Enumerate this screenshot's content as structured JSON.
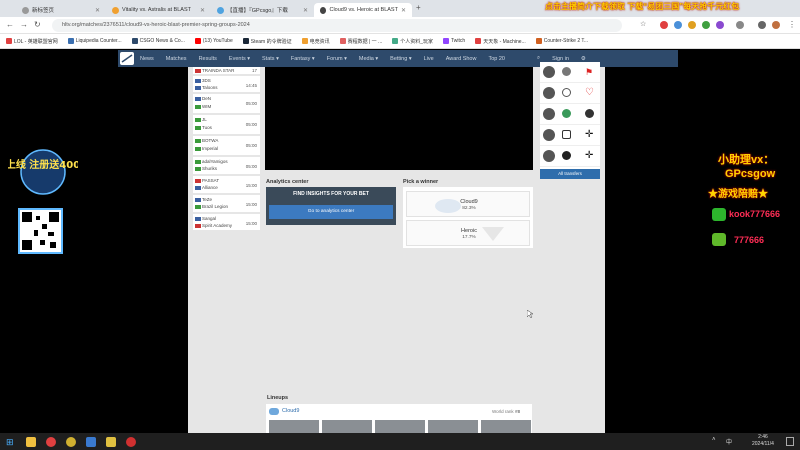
{
  "browser": {
    "tabs": [
      {
        "title": "新标签页",
        "color": "#999999"
      },
      {
        "title": "Vitality vs. Astralis at BLAST",
        "color": "#f0a030"
      },
      {
        "title": "【直播】『GPcsgo』下载",
        "color": "#4fa3e0"
      },
      {
        "title": "Cloud9 vs. Heroic at BLAST",
        "color": "#444444"
      }
    ],
    "new_tab": "+",
    "stream_banner": "点击主播简介下载领取 下载“易团三国”每天抢千元红包",
    "url": "hltv.org/matches/2376511/cloud9-vs-heroic-blast-premier-spring-groups-2024",
    "bookmarks": [
      {
        "label": "LOL - 英雄联盟官网",
        "color": "#e04040"
      },
      {
        "label": "Liquipedia Counter...",
        "color": "#3a6fb0"
      },
      {
        "label": "CSGO News & Co...",
        "color": "#2e4a6b"
      },
      {
        "label": "(13) YouTube",
        "color": "#ff0000"
      },
      {
        "label": "Steam 的令牌验证",
        "color": "#1b2838"
      },
      {
        "label": "电竞资讯",
        "color": "#f0a030"
      },
      {
        "label": "赛程数据 | 一 ...",
        "color": "#e06060"
      },
      {
        "label": "个人资料_玩家",
        "color": "#4a8"
      },
      {
        "label": "Twitch",
        "color": "#9146ff"
      },
      {
        "label": "天天象 - Machine...",
        "color": "#e04040"
      },
      {
        "label": "Counter-Strike 2 T...",
        "color": "#d06020"
      }
    ]
  },
  "nav": {
    "items": [
      "News",
      "Matches",
      "Results",
      "Events ▾",
      "Stats ▾",
      "Fantasy ▾",
      "Forum ▾",
      "Media ▾",
      "Betting ▾",
      "Live",
      "Award Show",
      "Top 20"
    ],
    "signin": "Sign in"
  },
  "matches": [
    {
      "t1": "TRAINDA STAR",
      "t2": "",
      "time": "17"
    },
    {
      "t1": "3DS",
      "t2": "Taloons",
      "time": "14:45"
    },
    {
      "t1": "DeN",
      "t2": "WIM",
      "time": "05:00"
    },
    {
      "t1": "JL",
      "t2": "Tuos",
      "time": "05:00"
    },
    {
      "t1": "BOTWA",
      "t2": "Imperial",
      "time": "05:00"
    },
    {
      "t1": "adalYamigos",
      "t2": "Shuriks",
      "time": "05:00"
    },
    {
      "t1": "PASSAT",
      "t2": "Alliance",
      "time": "15:00"
    },
    {
      "t1": "TeZe",
      "t2": "Brazil Legion",
      "time": "15:00"
    },
    {
      "t1": "Sangal",
      "t2": "Spirit Academy",
      "time": "15:00"
    }
  ],
  "transfers": {
    "button": "All transfers"
  },
  "analytics": {
    "title": "Analytics center",
    "text": "FIND INSIGHTS FOR YOUR BET",
    "button": "Go to analytics center"
  },
  "pick": {
    "title": "Pick a winner",
    "options": [
      {
        "team": "Cloud9",
        "pct": "82.3%"
      },
      {
        "team": "Heroic",
        "pct": "17.7%"
      }
    ]
  },
  "lineups": {
    "title": "Lineups",
    "team": "Cloud9",
    "world_rank": "World rank",
    "rank": "#8"
  },
  "overlay": {
    "badge": "新上线 注册送400元",
    "assistant_line1": "小助理vx：",
    "assistant_line2": "GPcsgow",
    "assistant_line3": "游戏陪赔",
    "wechat": "kook777666",
    "qq": "777666"
  },
  "taskbar": {
    "lang": "中",
    "time": "2:46",
    "date": "2024/11/4"
  }
}
